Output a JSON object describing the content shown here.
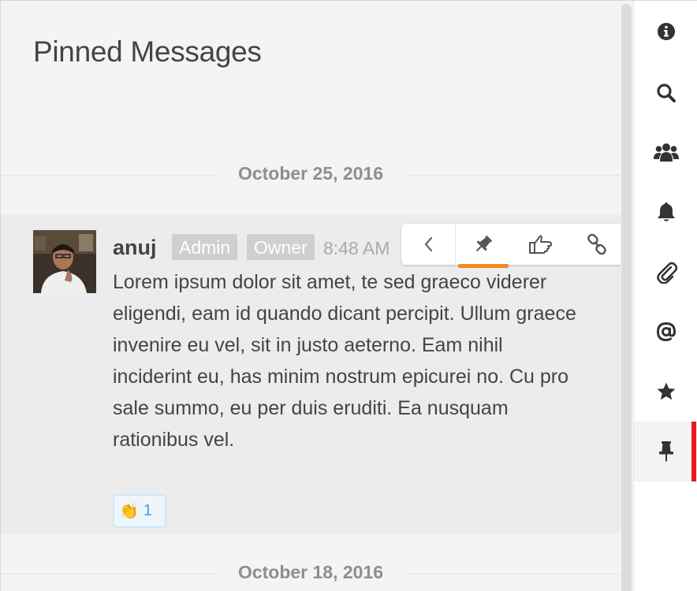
{
  "panel": {
    "title": "Pinned Messages"
  },
  "dates": [
    "October 25, 2016",
    "October 18, 2016"
  ],
  "message": {
    "author": "anuj",
    "roles": [
      "Admin",
      "Owner"
    ],
    "time": "8:48 AM",
    "text": "Lorem ipsum dolor sit amet, te sed graeco viderer eligendi, eam id quando dicant percipit. Ullum graece invenire eu vel, sit in justo aeterno. Eam nihil inciderint eu, has minim nostrum epicurei no. Cu pro sale summo, eu per duis eruditi. Ea nusquam rationibus vel.",
    "reaction": {
      "emoji": "👏",
      "count": "1"
    }
  },
  "toolbar": {
    "icons": [
      "chevron-left-icon",
      "pin-icon",
      "hand-pointing-icon",
      "link-icon"
    ],
    "accent": "#f08a1c"
  },
  "sidebar": {
    "items": [
      "info-icon",
      "search-icon",
      "users-icon",
      "bell-icon",
      "paperclip-icon",
      "at-icon",
      "star-icon",
      "pin-icon"
    ],
    "active": "pin-icon",
    "active_color": "#e8191f"
  }
}
